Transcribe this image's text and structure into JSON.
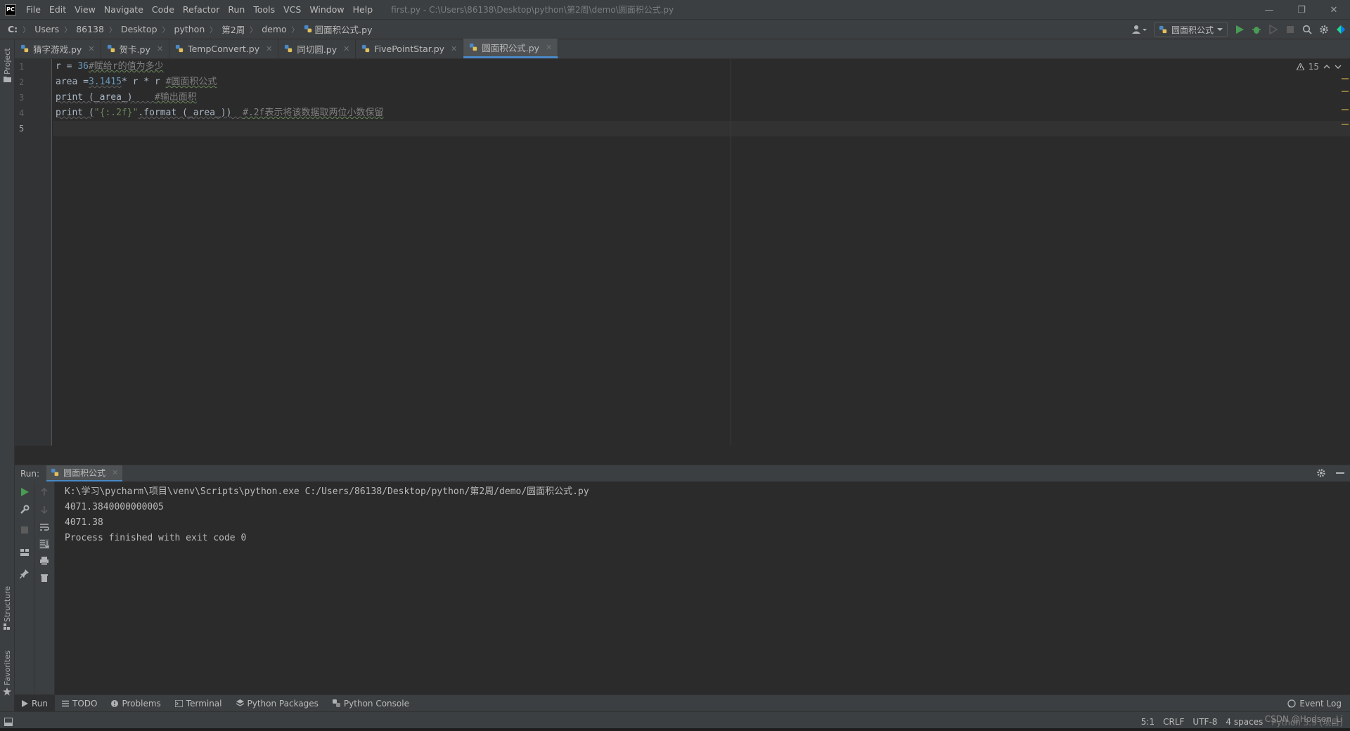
{
  "app": {
    "logo": "PC",
    "title": "first.py - C:\\Users\\86138\\Desktop\\python\\第2周\\demo\\圆面积公式.py"
  },
  "menu": [
    "File",
    "Edit",
    "View",
    "Navigate",
    "Code",
    "Refactor",
    "Run",
    "Tools",
    "VCS",
    "Window",
    "Help"
  ],
  "window_controls": {
    "minimize": "—",
    "restore": "❐",
    "close": "✕"
  },
  "breadcrumb": [
    "C:",
    "Users",
    "86138",
    "Desktop",
    "python",
    "第2周",
    "demo",
    "圆面积公式.py"
  ],
  "run_config": {
    "label": "圆面积公式"
  },
  "left_strip": {
    "project": "Project",
    "structure": "Structure",
    "favorites": "Favorites"
  },
  "tabs": [
    {
      "label": "猜字游戏.py",
      "active": false
    },
    {
      "label": "贺卡.py",
      "active": false
    },
    {
      "label": "TempConvert.py",
      "active": false
    },
    {
      "label": "同切圆.py",
      "active": false
    },
    {
      "label": "FivePointStar.py",
      "active": false
    },
    {
      "label": "圆面积公式.py",
      "active": true
    }
  ],
  "editor": {
    "line_numbers": [
      "1",
      "2",
      "3",
      "4",
      "5"
    ],
    "lines": [
      {
        "parts": [
          "r = ",
          "36",
          "#赋给r的值为多少"
        ]
      },
      {
        "parts": [
          "area =",
          "3.1415",
          "* r * r ",
          "#圆面积公式"
        ]
      },
      {
        "parts": [
          "print (_area_)    ",
          "#输出面积"
        ]
      },
      {
        "parts": [
          "print (",
          "\"{:.2f}\"",
          ".format (_area_))  ",
          "#.2f表示将该数据取两位小数保留"
        ]
      },
      {
        "parts": [
          ""
        ]
      }
    ],
    "warnings": "15"
  },
  "run_panel": {
    "label": "Run:",
    "tab": "圆面积公式",
    "console": [
      "K:\\学习\\pycharm\\项目\\venv\\Scripts\\python.exe C:/Users/86138/Desktop/python/第2周/demo/圆面积公式.py",
      "4071.3840000000005",
      "4071.38",
      "",
      "Process finished with exit code 0"
    ]
  },
  "tool_windows": [
    {
      "label": "Run",
      "icon": "play-icon"
    },
    {
      "label": "TODO",
      "icon": "list-icon"
    },
    {
      "label": "Problems",
      "icon": "info-icon"
    },
    {
      "label": "Terminal",
      "icon": "terminal-icon"
    },
    {
      "label": "Python Packages",
      "icon": "layers-icon"
    },
    {
      "label": "Python Console",
      "icon": "python-icon"
    }
  ],
  "event_log": "Event Log",
  "status": {
    "position": "5:1",
    "line_sep": "CRLF",
    "encoding": "UTF-8",
    "indent": "4 spaces",
    "interpreter": "Python 3.9 (项目)",
    "watermark": "CSDN @Hodson_Li"
  },
  "colors": {
    "accent": "#4a88c7",
    "number": "#6897bb",
    "string": "#6a8759",
    "comment": "#808080"
  }
}
